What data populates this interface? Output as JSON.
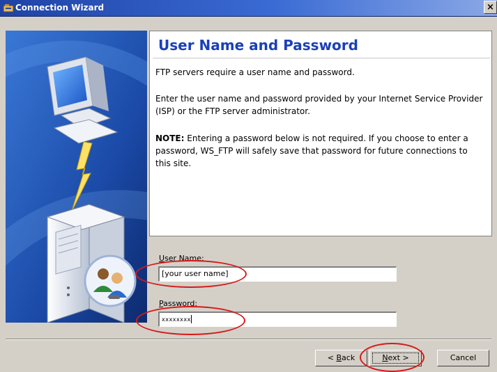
{
  "window": {
    "title": "Connection Wizard",
    "close_glyph": "×"
  },
  "page": {
    "heading": "User Name and Password",
    "paragraph1": "FTP servers require a user name and password.",
    "paragraph2": "Enter the user name and password provided by your Internet Service Provider (ISP) or the FTP server administrator.",
    "note_label": "NOTE:",
    "note_text": " Entering a password below is not required. If you choose to enter a password, WS_FTP will safely save that password for future connections to this site."
  },
  "form": {
    "username": {
      "label_accel": "U",
      "label_rest": "ser Name:",
      "value": "[your user name]"
    },
    "password": {
      "label_accel": "P",
      "label_rest": "assword:",
      "value": "xxxxxxxx"
    }
  },
  "buttons": {
    "back": {
      "prefix": "< ",
      "accel": "B",
      "rest": "ack"
    },
    "next": {
      "accel": "N",
      "rest": "ext >"
    },
    "cancel": {
      "label": "Cancel"
    }
  },
  "icons": {
    "app": "connection-wizard-icon",
    "illustration": "computer-server-lightning-illustration",
    "users": "users-icon"
  },
  "colors": {
    "title_bar": "#1f43a6",
    "heading": "#1a40b8",
    "side_panel": "#14337a",
    "annotation": "#d61a1a",
    "dialog_bg": "#d4d0c8"
  }
}
